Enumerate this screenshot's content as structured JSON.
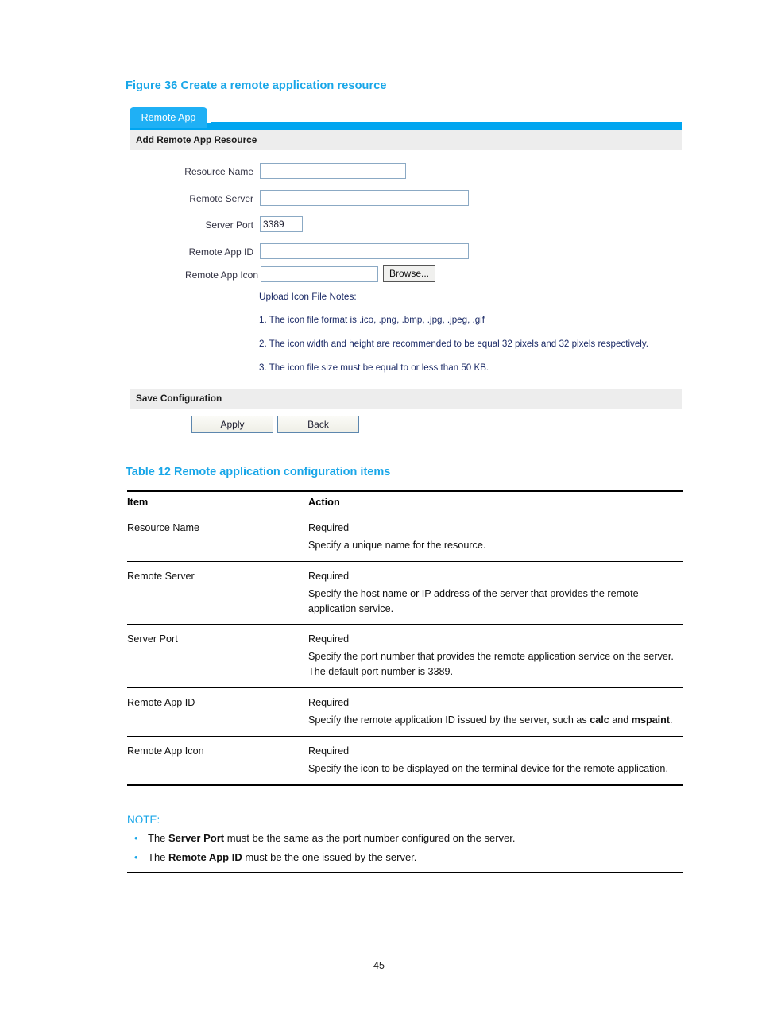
{
  "figure": {
    "caption": "Figure 36 Create a remote application resource",
    "tab_label": "Remote App",
    "section_header": "Add Remote App Resource",
    "fields": [
      {
        "label": "Resource Name",
        "value": "",
        "placeholder": ""
      },
      {
        "label": "Remote Server",
        "value": "",
        "placeholder": ""
      },
      {
        "label": "Server Port",
        "value": "3389",
        "placeholder": ""
      },
      {
        "label": "Remote App ID",
        "value": "",
        "placeholder": ""
      },
      {
        "label": "Remote App Icon",
        "value": "",
        "placeholder": ""
      }
    ],
    "browse_label": "Browse...",
    "notes_title": "Upload Icon File Notes:",
    "notes": [
      "1. The icon file format is .ico, .png, .bmp, .jpg, .jpeg, .gif",
      "2. The icon width and height are recommended to be equal 32 pixels and 32 pixels respectively.",
      "3. The icon file size must be equal to or less than 50 KB."
    ],
    "save_header": "Save Configuration",
    "apply_label": "Apply",
    "back_label": "Back",
    "accent_color": "#00a5f0",
    "tab_color": "#1fb0f5"
  },
  "table": {
    "caption": "Table 12 Remote application configuration items",
    "headers": [
      "Item",
      "Action"
    ],
    "rows": [
      {
        "item": "Resource Name",
        "required": "Required",
        "description": "Specify a unique name for the resource."
      },
      {
        "item": "Remote Server",
        "required": "Required",
        "description": "Specify the host name or IP address of the server that provides the remote application service."
      },
      {
        "item": "Server Port",
        "required": "Required",
        "description": "Specify the port number that provides the remote application service on the server. The default port number is 3389."
      },
      {
        "item": "Remote App ID",
        "required": "Required",
        "description_html": "Specify the remote application ID issued by the server, such as <b>calc</b> and <b>mspaint</b>."
      },
      {
        "item": "Remote App Icon",
        "required": "Required",
        "description": "Specify the icon to be displayed on the terminal device for the remote application."
      }
    ]
  },
  "note": {
    "label": "NOTE:",
    "bullet_char": "•",
    "items_html": [
      "The <b>Server Port</b> must be the same as the port number configured on the server.",
      "The <b>Remote App ID</b> must be the one issued by the server."
    ],
    "color": "#18a6e8"
  },
  "footer": {
    "page_number": "45"
  }
}
